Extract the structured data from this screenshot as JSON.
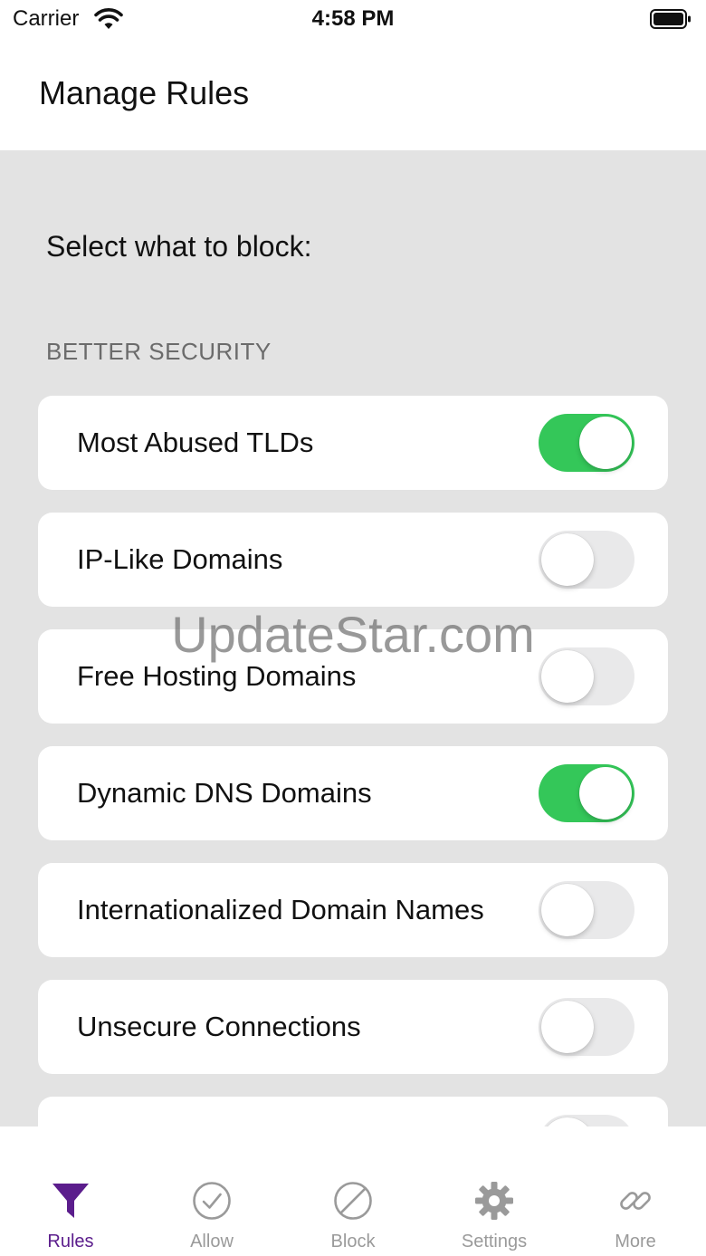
{
  "status_bar": {
    "carrier": "Carrier",
    "time": "4:58 PM",
    "wifi_icon": "wifi-icon",
    "battery_icon": "battery-icon"
  },
  "header": {
    "title": "Manage Rules"
  },
  "main": {
    "prompt": "Select what to block:",
    "section_title": "BETTER SECURITY",
    "rules": [
      {
        "label": "Most Abused TLDs",
        "enabled": true
      },
      {
        "label": "IP-Like Domains",
        "enabled": false
      },
      {
        "label": "Free Hosting Domains",
        "enabled": false
      },
      {
        "label": "Dynamic DNS Domains",
        "enabled": true
      },
      {
        "label": "Internationalized Domain Names",
        "enabled": false
      },
      {
        "label": "Unsecure Connections",
        "enabled": false
      },
      {
        "label": "",
        "enabled": false
      }
    ]
  },
  "watermark": "UpdateStar.com",
  "tab_bar": {
    "tabs": [
      {
        "label": "Rules",
        "icon": "funnel-icon",
        "active": true
      },
      {
        "label": "Allow",
        "icon": "checkmark-circle-icon",
        "active": false
      },
      {
        "label": "Block",
        "icon": "prohibited-icon",
        "active": false
      },
      {
        "label": "Settings",
        "icon": "gear-icon",
        "active": false
      },
      {
        "label": "More",
        "icon": "link-icon",
        "active": false
      }
    ]
  },
  "colors": {
    "accent": "#5b1d8c",
    "toggle_on": "#34c759",
    "toggle_off": "#e9e9ea",
    "background": "#e3e3e3",
    "inactive_tab": "#9a9a9a"
  }
}
